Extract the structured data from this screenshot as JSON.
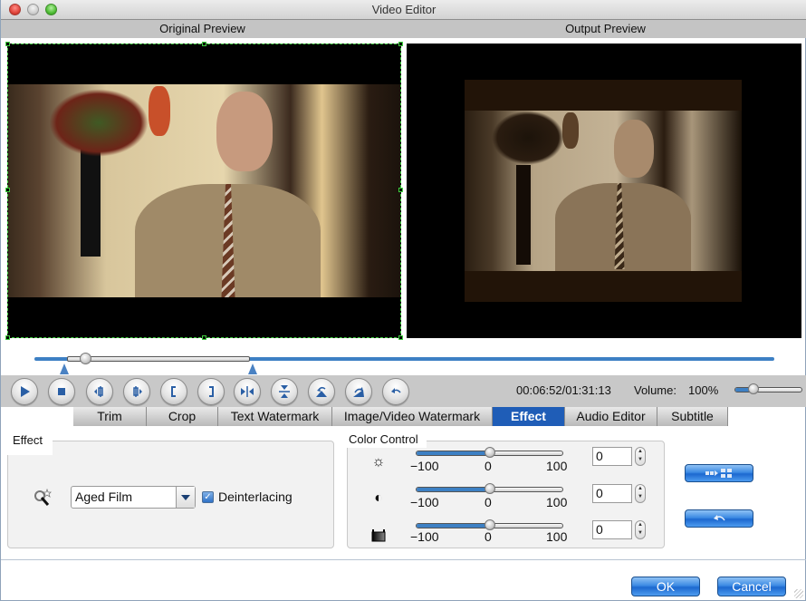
{
  "window": {
    "title": "Video Editor"
  },
  "previews": {
    "original_label": "Original Preview",
    "output_label": "Output Preview"
  },
  "timeline": {
    "playhead_fraction": 0.074,
    "selection_start_fraction": 0.044,
    "selection_end_fraction": 0.291
  },
  "toolbar": {
    "buttons": [
      {
        "name": "play-button",
        "icon": "play-icon"
      },
      {
        "name": "stop-button",
        "icon": "stop-icon"
      },
      {
        "name": "prev-frame-button",
        "icon": "step-back-icon"
      },
      {
        "name": "next-frame-button",
        "icon": "step-forward-icon"
      },
      {
        "name": "set-start-button",
        "icon": "left-bracket-icon"
      },
      {
        "name": "set-end-button",
        "icon": "right-bracket-icon"
      },
      {
        "name": "flip-horizontal-button",
        "icon": "flip-horizontal-icon"
      },
      {
        "name": "flip-vertical-button",
        "icon": "flip-vertical-icon"
      },
      {
        "name": "rotate-left-button",
        "icon": "rotate-left-icon"
      },
      {
        "name": "rotate-right-button",
        "icon": "rotate-right-icon"
      },
      {
        "name": "undo-button",
        "icon": "undo-icon"
      }
    ],
    "time": "00:06:52/01:31:13",
    "volume_label": "Volume:",
    "volume_value": "100%",
    "volume_fraction": 0.28
  },
  "tabs": [
    {
      "label": "Trim",
      "active": false
    },
    {
      "label": "Crop",
      "active": false
    },
    {
      "label": "Text Watermark",
      "active": false
    },
    {
      "label": "Image/Video Watermark",
      "active": false
    },
    {
      "label": "Effect",
      "active": true
    },
    {
      "label": "Audio Editor",
      "active": false
    },
    {
      "label": "Subtitle",
      "active": false
    }
  ],
  "effect": {
    "group_label": "Effect",
    "selected_effect": "Aged Film",
    "deinterlacing_label": "Deinterlacing",
    "deinterlacing_checked": true
  },
  "color_control": {
    "group_label": "Color Control",
    "rows": [
      {
        "name": "brightness",
        "icon": "brightness-icon",
        "min": "−100",
        "mid": "0",
        "max": "100",
        "value": "0",
        "fraction": 0.5
      },
      {
        "name": "contrast",
        "icon": "contrast-icon",
        "min": "−100",
        "mid": "0",
        "max": "100",
        "value": "0",
        "fraction": 0.5
      },
      {
        "name": "saturation",
        "icon": "saturation-icon",
        "min": "−100",
        "mid": "0",
        "max": "100",
        "value": "0",
        "fraction": 0.5
      }
    ]
  },
  "buttons": {
    "apply_to_all": "apply-to-all-icon",
    "reset": "reset-icon",
    "ok": "OK",
    "cancel": "Cancel"
  },
  "colors": {
    "accent": "#1f5db7",
    "track": "#3d80c4",
    "crop_border": "#3fcf3f"
  }
}
